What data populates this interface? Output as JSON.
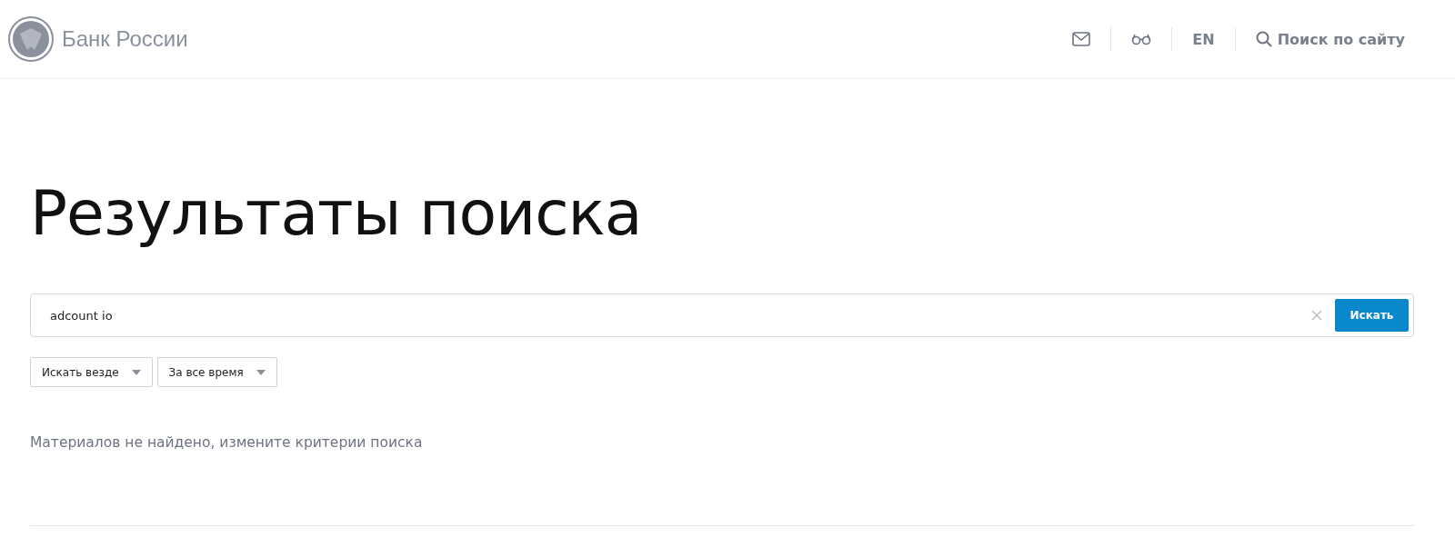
{
  "header": {
    "logo_text": "Банк России",
    "language": "EN",
    "site_search": "Поиск по сайту"
  },
  "title": "Результаты поиска",
  "search": {
    "value": "adcount io",
    "button": "Искать"
  },
  "filters": [
    {
      "label": "Искать везде"
    },
    {
      "label": "За все время"
    }
  ],
  "message": "Материалов не найдено, измените критерии поиска"
}
